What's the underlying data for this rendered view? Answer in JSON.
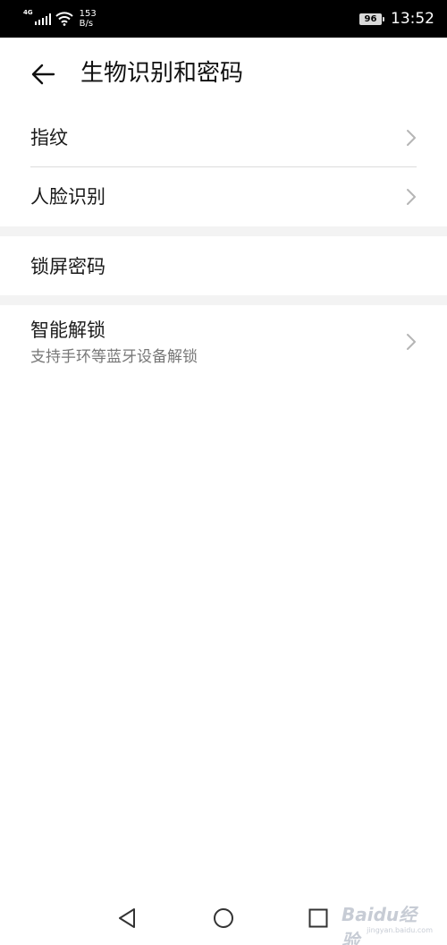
{
  "status_bar": {
    "network_type": "4G",
    "speed_value": "153",
    "speed_unit": "B/s",
    "battery": "96",
    "time": "13:52"
  },
  "header": {
    "back_icon": "arrow-left-icon",
    "title": "生物识别和密码"
  },
  "items": [
    {
      "label": "指纹",
      "has_chevron": true
    },
    {
      "label": "人脸识别",
      "has_chevron": true
    },
    {
      "label": "锁屏密码",
      "has_chevron": false
    },
    {
      "label": "智能解锁",
      "subtitle": "支持手环等蓝牙设备解锁",
      "has_chevron": true
    }
  ],
  "nav_bar": {
    "back": "triangle-back-icon",
    "home": "circle-home-icon",
    "recents": "square-recents-icon"
  },
  "watermark": {
    "brand": "Baidu经验",
    "url": "jingyan.baidu.com"
  },
  "colors": {
    "status_bar_bg": "#000000",
    "background": "#ffffff",
    "section_gap": "#f3f3f3",
    "primary_text": "#1a1a1a",
    "secondary_text": "#777777",
    "chevron": "#b5b5b5"
  }
}
